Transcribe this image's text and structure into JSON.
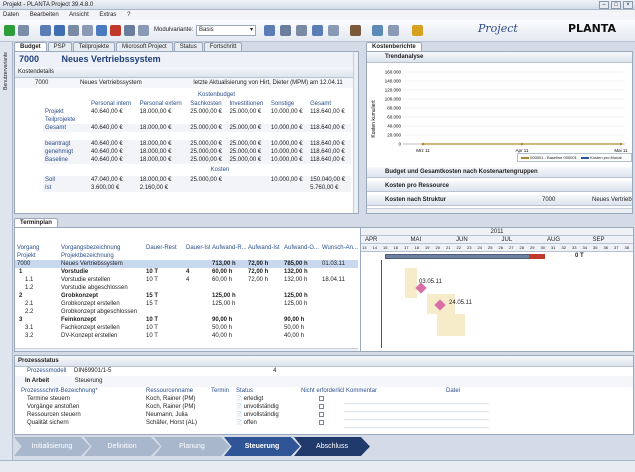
{
  "window": {
    "title": "Projekt - PLANTA Project 39.4.8.0"
  },
  "menu": [
    "Daten",
    "Bearbeiten",
    "Ansicht",
    "Extras",
    "?"
  ],
  "toolbar": {
    "modulvariante_label": "Modulvariante:",
    "modulvariante_value": "Basis"
  },
  "logos": {
    "project": "Project",
    "planta": "PLANTA"
  },
  "sidebar": {
    "label": "Benutzervariante"
  },
  "main_tabs": [
    "Budget",
    "PSP",
    "Teilprojekte",
    "Microsoft Project",
    "Status",
    "Fortschritt"
  ],
  "budget": {
    "title": "Kostendetails",
    "project_id": "7000",
    "project_name": "Neues Vertriebssystem",
    "row_id": "7000",
    "row_name": "Neues Vertriebssystem",
    "last_update": "letzte Aktualisierung von Hirt, Dieter (MPM) am 12.04.11",
    "section_label": "Kostenbudget",
    "columns": [
      "Personal intern",
      "Personal extern",
      "Sachkosten",
      "Investitionen",
      "Sonstige",
      "Gesamt"
    ],
    "rows_budget": [
      {
        "label": "Projekt",
        "values": [
          "40.640,00 €",
          "18.000,00 €",
          "25.000,00 €",
          "25.000,00 €",
          "10.000,00 €",
          "118.640,00 €"
        ]
      },
      {
        "label": "Teilprojekte",
        "values": [
          "",
          "",
          "",
          "",
          "",
          ""
        ]
      },
      {
        "label": "Gesamt",
        "values": [
          "40.640,00 €",
          "18.000,00 €",
          "25.000,00 €",
          "25.000,00 €",
          "10.000,00 €",
          "118.640,00 €"
        ]
      }
    ],
    "rows_status": [
      {
        "label": "beantragt",
        "values": [
          "40.640,00 €",
          "18.000,00 €",
          "25.000,00 €",
          "25.000,00 €",
          "10.000,00 €",
          "118.640,00 €"
        ]
      },
      {
        "label": "genehmigt",
        "values": [
          "40.640,00 €",
          "18.000,00 €",
          "25.000,00 €",
          "25.000,00 €",
          "10.000,00 €",
          "118.640,00 €"
        ]
      },
      {
        "label": "Baseline",
        "values": [
          "40.640,00 €",
          "18.000,00 €",
          "25.000,00 €",
          "25.000,00 €",
          "10.000,00 €",
          "118.640,00 €"
        ]
      }
    ],
    "kosten_label": "Kosten",
    "rows_kosten": [
      {
        "label": "Soll",
        "values": [
          "47.040,00 €",
          "18.000,00 €",
          "25.000,00 €",
          "",
          "10.000,00 €",
          "150.040,00 €"
        ]
      },
      {
        "label": "Ist",
        "values": [
          "3.600,00 €",
          "2.160,00 €",
          "",
          "",
          "",
          "5.760,00 €"
        ]
      }
    ]
  },
  "cost_reports": {
    "tab": "Kostenberichte",
    "trend_title": "Trendanalyse",
    "ylabel": "Kosten kumuliert",
    "yticks": [
      "160.000",
      "140.000",
      "120.000",
      "100.000",
      "80.000",
      "60.000",
      "40.000",
      "20.000",
      "0"
    ],
    "xticks": [
      "Mrz 11",
      "Apr 11",
      "Mai 11"
    ],
    "legend": [
      "000001 - Baseline 000001",
      "Kosten pro Monat"
    ],
    "sections": [
      "Budget und Gesamtkosten nach Kostenartengruppen",
      "Kosten pro Ressource",
      "Kosten nach Struktur"
    ],
    "struktur_id": "7000",
    "struktur_name": "Neues Vertriebs"
  },
  "chart_data": {
    "type": "area",
    "title": "Trendanalyse",
    "ylabel": "Kosten kumuliert",
    "x": [
      "Mrz 11",
      "Apr 11",
      "Mai 11"
    ],
    "ylim": [
      0,
      160000
    ],
    "series": [
      {
        "name": "000001 - Baseline 000001",
        "values": [
          0,
          0,
          0
        ]
      }
    ]
  },
  "termin": {
    "tab": "Terminplan",
    "columns": [
      "Vorgang",
      "Vorgangsbezeichnung",
      "Dauer-Rest",
      "Dauer-Ist",
      "Aufwand-R...",
      "Aufwand-Ist",
      "Aufwand-G...",
      "Wunsch-An..."
    ],
    "sub": {
      "c1": "Projekt",
      "c2": "Projektbezeichnung"
    },
    "project_row": {
      "id": "7000",
      "name": "Neues Vertriebssystem",
      "aufwand_r": "713,00 h",
      "aufwand_ist": "72,00 h",
      "aufwand_g": "785,00 h",
      "wunsch": "01.03.11"
    },
    "rows": [
      {
        "id": "1",
        "name": "Vorstudie",
        "dauer": "10 T",
        "ist": "4",
        "ar": "60,00 h",
        "ai": "72,00 h",
        "ag": "132,00 h",
        "w": "",
        "bold": true
      },
      {
        "id": "1.1",
        "name": "Vorstudie erstellen",
        "dauer": "10 T",
        "ist": "4",
        "ar": "60,00 h",
        "ai": "72,00 h",
        "ag": "132,00 h",
        "w": "18.04.11",
        "bold": false
      },
      {
        "id": "1.2",
        "name": "Vorstudie abgeschlossen",
        "dauer": "",
        "ist": "",
        "ar": "",
        "ai": "",
        "ag": "",
        "w": "",
        "bold": false
      },
      {
        "id": "2",
        "name": "Grobkonzept",
        "dauer": "15 T",
        "ist": "",
        "ar": "125,00 h",
        "ai": "",
        "ag": "125,00 h",
        "w": "",
        "bold": true
      },
      {
        "id": "2.1",
        "name": "Grobkonzept erstellen",
        "dauer": "15 T",
        "ist": "",
        "ar": "125,00 h",
        "ai": "",
        "ag": "125,00 h",
        "w": "",
        "bold": false
      },
      {
        "id": "2.2",
        "name": "Grobkonzept abgeschlossen",
        "dauer": "",
        "ist": "",
        "ar": "",
        "ai": "",
        "ag": "",
        "w": "",
        "bold": false
      },
      {
        "id": "3",
        "name": "Feinkonzept",
        "dauer": "10 T",
        "ist": "",
        "ar": "90,00 h",
        "ai": "",
        "ag": "90,00 h",
        "w": "",
        "bold": true
      },
      {
        "id": "3.1",
        "name": "Fachkonzept erstellen",
        "dauer": "10 T",
        "ist": "",
        "ar": "50,00 h",
        "ai": "",
        "ag": "50,00 h",
        "w": "",
        "bold": false
      },
      {
        "id": "3.2",
        "name": "DV-Konzept erstellen",
        "dauer": "10 T",
        "ist": "",
        "ar": "40,00 h",
        "ai": "",
        "ag": "40,00 h",
        "w": "",
        "bold": false
      }
    ],
    "gantt": {
      "year": "2011",
      "months": [
        "APR",
        "MAI",
        "JUN",
        "JUL",
        "AUG",
        "SEP"
      ],
      "weeks": [
        "13",
        "14",
        "15",
        "16",
        "17",
        "18",
        "19",
        "20",
        "21",
        "22",
        "23",
        "24",
        "25",
        "26",
        "27",
        "28",
        "29",
        "30",
        "31",
        "32",
        "33",
        "34",
        "35",
        "36",
        "37",
        "38"
      ],
      "end_label": "0 T",
      "milestone1": "03.05.11",
      "milestone2": "24.05.11"
    }
  },
  "prozess": {
    "title": "Prozessstatus",
    "modell_label": "Prozessmodell",
    "modell_value": "DIN69901/1-5",
    "modell_num": "4",
    "phase_label": "In Arbeit",
    "phase_name": "Steuerung",
    "columns": [
      "Prozessschritt-Bezeichnung*",
      "Ressourcenname",
      "Termin",
      "Status",
      "Nicht erforderlich",
      "Kommentar",
      "Datei"
    ],
    "rows": [
      {
        "step": "Termine steuern",
        "res": "Koch, Rainer (PM)",
        "status": "erledigt"
      },
      {
        "step": "Vorgänge anstoßen",
        "res": "Koch, Rainer (PM)",
        "status": "unvollständig"
      },
      {
        "step": "Ressourcen steuern",
        "res": "Neumann, Julia",
        "status": "unvollständig"
      },
      {
        "step": "Qualität sichern",
        "res": "Schäfer, Horst (AL)",
        "status": "offen"
      }
    ]
  },
  "phases": [
    "Initialisierung",
    "Definition",
    "Planung",
    "Steuerung",
    "Abschluss"
  ],
  "colors": {
    "phase_done": "#a9b7cc",
    "phase_active": "#2f5597",
    "phase_next": "#203a6b",
    "gantt_bar": "#6f7fa0",
    "gantt_today": "#c0392b"
  }
}
